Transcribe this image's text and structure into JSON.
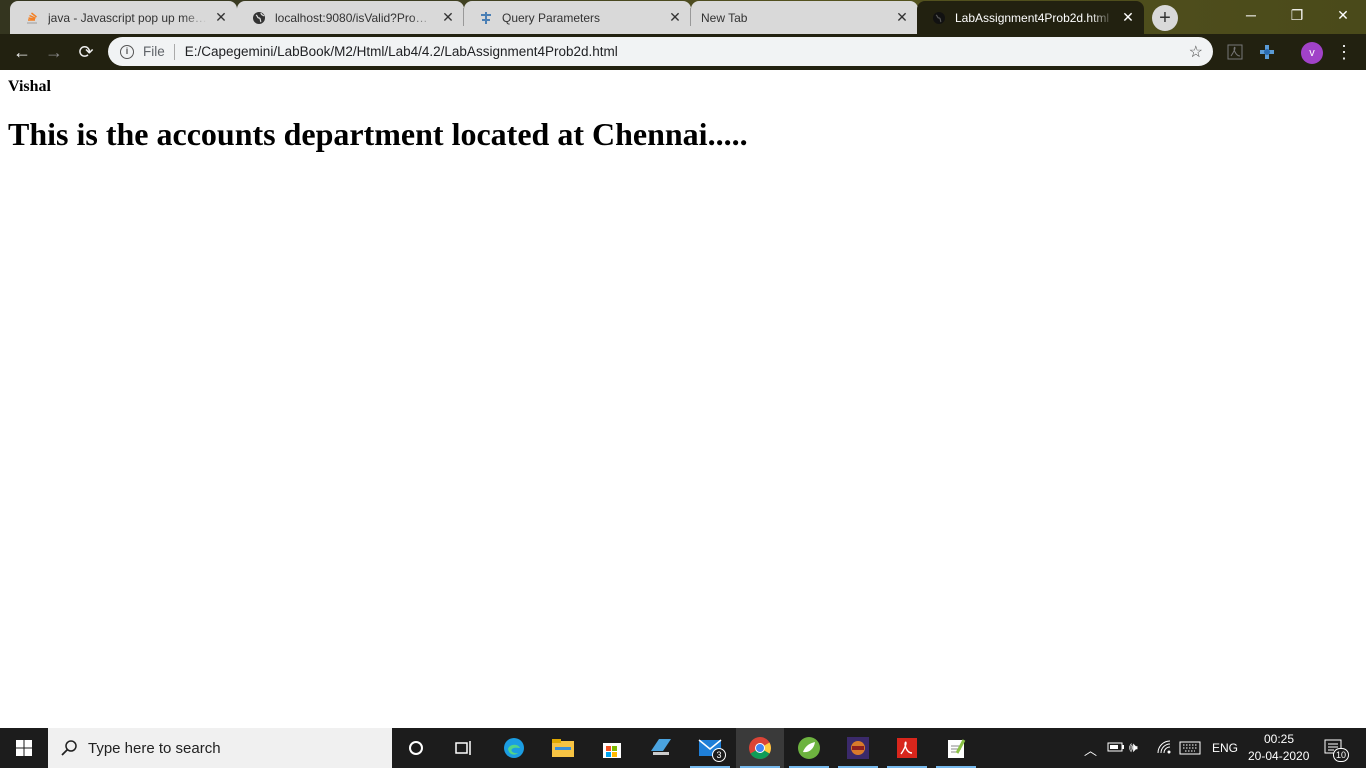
{
  "browser": {
    "tabs": [
      {
        "title": "java - Javascript pop up messa",
        "icon": "stackoverflow-icon",
        "active": false
      },
      {
        "title": "localhost:9080/isValid?Product",
        "icon": "globe-icon",
        "active": false
      },
      {
        "title": "Query Parameters",
        "icon": "query-params-icon",
        "active": false
      },
      {
        "title": "New Tab",
        "icon": "",
        "active": false
      },
      {
        "title": "LabAssignment4Prob2d.html",
        "icon": "globe-icon",
        "active": true
      }
    ],
    "address": {
      "scheme_label": "File",
      "url": "E:/Capegemini/LabBook/M2/Html/Lab4/4.2/LabAssignment4Prob2d.html"
    },
    "profile_initial": "v"
  },
  "page": {
    "name": "Vishal",
    "heading": "This is the accounts department located at Chennai....."
  },
  "taskbar": {
    "search_placeholder": "Type here to search",
    "mail_badge": "3",
    "language": "ENG",
    "time": "00:25",
    "date": "20-04-2020",
    "notification_count": "10"
  }
}
